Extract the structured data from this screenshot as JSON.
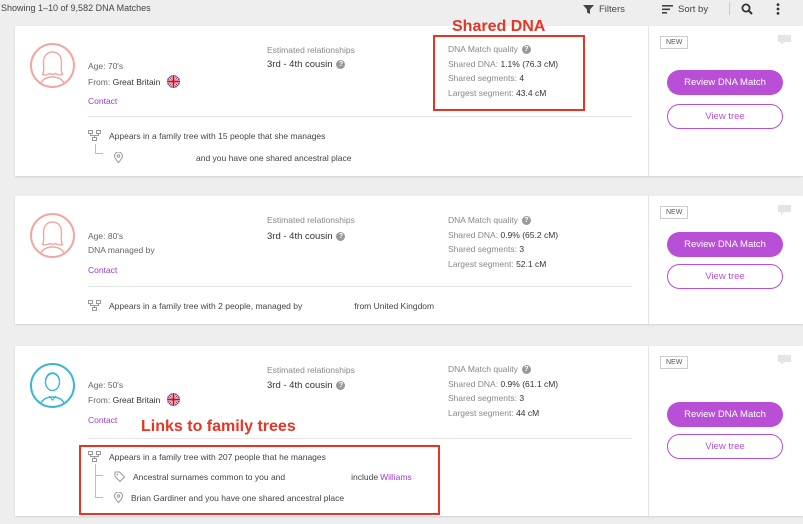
{
  "topbar": {
    "count": "Showing 1–10 of 9,582 DNA Matches",
    "filters": "Filters",
    "sort": "Sort by"
  },
  "labels": {
    "estimated_relationships": "Estimated relationships",
    "dna_match_quality": "DNA Match quality",
    "shared_dna": "Shared DNA:",
    "shared_segments": "Shared segments:",
    "largest_segment": "Largest segment:",
    "contact": "Contact",
    "new_badge": "NEW",
    "review": "Review DNA Match",
    "view_tree": "View tree",
    "help": "?"
  },
  "annotations": {
    "shared_dna": "Shared DNA",
    "family_trees": "Links to family trees"
  },
  "matches": [
    {
      "age": "Age: 70's",
      "origin_label": "From:",
      "origin_value": "Great Britain",
      "relationship": "3rd - 4th cousin",
      "shared_dna": "1.1% (76.3 cM)",
      "segments": "4",
      "largest": "43.4 cM",
      "tree_line": "Appears in a family tree with 15 people that she manages",
      "place_line": "and you have one shared ancestral place"
    },
    {
      "age": "Age: 80's",
      "managed_by": "DNA managed by",
      "relationship": "3rd - 4th cousin",
      "shared_dna": "0.9% (65.2 cM)",
      "segments": "3",
      "largest": "52.1 cM",
      "tree_line_a": "Appears in a family tree with 2 people, managed by",
      "tree_line_b": "from United Kingdom"
    },
    {
      "age": "Age: 50's",
      "origin_label": "From:",
      "origin_value": "Great Britain",
      "relationship": "3rd - 4th cousin",
      "shared_dna": "0.9% (61.1 cM)",
      "segments": "3",
      "largest": "44 cM",
      "tree_line": "Appears in a family tree with 207 people that he manages",
      "surname_line": "Ancestral surnames common to you and",
      "surname_include": "include",
      "surname_link": "Williams",
      "place_line": "Brian Gardiner and you have one shared ancestral place"
    }
  ],
  "colors": {
    "accent": "#b84fd6",
    "annotation": "#e53524"
  }
}
